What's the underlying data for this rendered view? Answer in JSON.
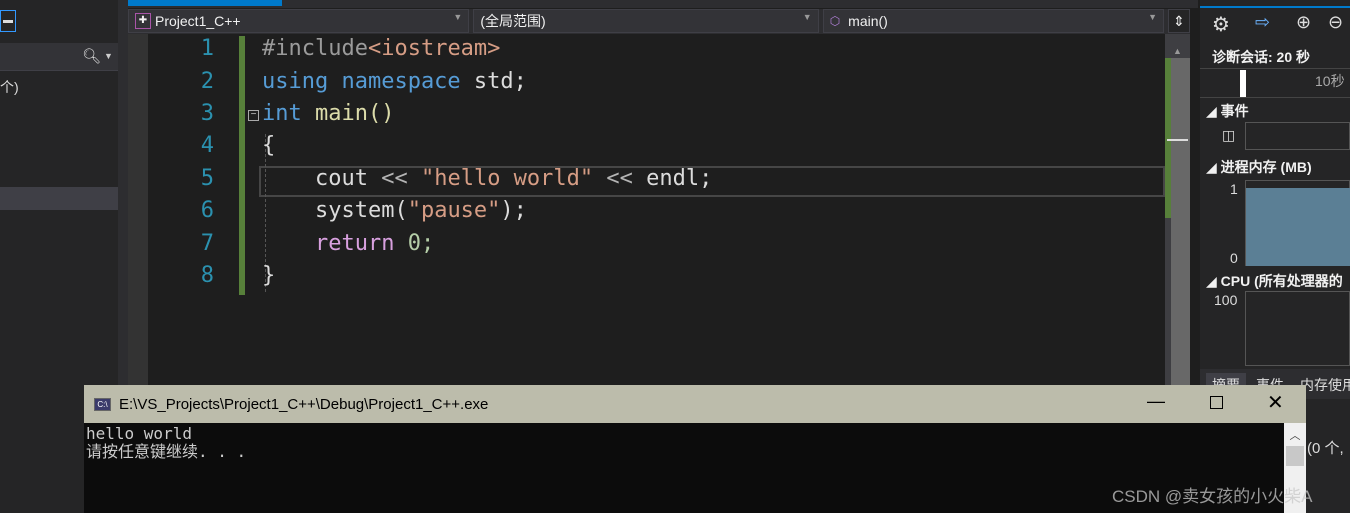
{
  "left_panel": {
    "partial_text": "个)"
  },
  "nav": {
    "project": "Project1_C++",
    "scope": "(全局范围)",
    "member": "main()"
  },
  "editor": {
    "line_numbers": [
      "1",
      "2",
      "3",
      "4",
      "5",
      "6",
      "7",
      "8"
    ],
    "lines": [
      [
        {
          "t": "#include",
          "c": "#9b9b9b"
        },
        {
          "t": "<iostream>",
          "c": "#d69d85"
        }
      ],
      [
        {
          "t": "using namespace ",
          "c": "#569cd6"
        },
        {
          "t": "std;",
          "c": "#dcdcdc"
        }
      ],
      [
        {
          "t": "int ",
          "c": "#569cd6"
        },
        {
          "t": "main()",
          "c": "#dcdcaa"
        }
      ],
      [
        {
          "t": "{",
          "c": "#dcdcdc"
        }
      ],
      [
        {
          "t": "    cout ",
          "c": "#dcdcdc"
        },
        {
          "t": "<<",
          "c": "#b4b4b4"
        },
        {
          "t": " \"hello world\" ",
          "c": "#d69d85"
        },
        {
          "t": "<<",
          "c": "#b4b4b4"
        },
        {
          "t": " endl;",
          "c": "#dcdcdc"
        }
      ],
      [
        {
          "t": "    system(",
          "c": "#dcdcdc"
        },
        {
          "t": "\"pause\"",
          "c": "#d69d85"
        },
        {
          "t": ");",
          "c": "#dcdcdc"
        }
      ],
      [
        {
          "t": "    return ",
          "c": "#d8a0df"
        },
        {
          "t": "0;",
          "c": "#b5cea8"
        }
      ],
      [
        {
          "t": "}",
          "c": "#dcdcdc"
        }
      ]
    ]
  },
  "diagnostics": {
    "session": "诊断会话: 20 秒",
    "tick": "10秒",
    "events": "事件",
    "memory": "进程内存 (MB)",
    "mem_max": "1",
    "mem_min": "0",
    "cpu": "CPU (所有处理器的",
    "cpu_max": "100",
    "tabs": [
      "摘要",
      "事件",
      "内存使用"
    ],
    "partial_count": "(0 个,"
  },
  "console": {
    "title": "E:\\VS_Projects\\Project1_C++\\Debug\\Project1_C++.exe",
    "output": [
      "hello world",
      "请按任意键继续. . ."
    ]
  },
  "watermark": "CSDN @卖女孩的小火柴A"
}
